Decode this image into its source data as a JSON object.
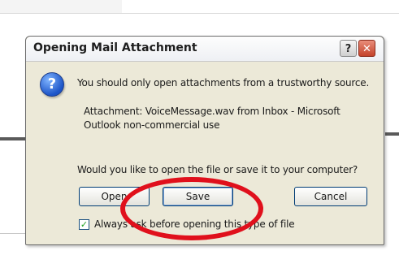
{
  "dialog": {
    "title": "Opening Mail Attachment",
    "help_glyph": "?",
    "close_glyph": "✕",
    "icon": "question-icon",
    "message": "You should only open attachments from a trustworthy source.",
    "attachment_line1": "Attachment: VoiceMessage.wav from Inbox - Microsoft",
    "attachment_line2": "Outlook non-commercial use",
    "question": "Would you like to open the file or save it to your computer?",
    "buttons": {
      "open": "Open",
      "save": "Save",
      "cancel": "Cancel"
    },
    "checkbox": {
      "label": "Always ask before opening this type of file",
      "checked": true
    }
  },
  "annotation": {
    "type": "red-circle",
    "target": "save-button",
    "color": "#e0101c"
  },
  "colors": {
    "dialog_bg": "#ece9d8",
    "button_border": "#003c74",
    "close_red": "#c4422a"
  }
}
